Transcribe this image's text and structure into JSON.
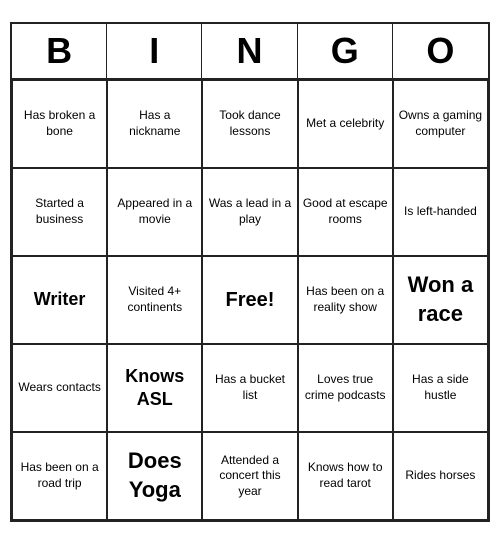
{
  "header": {
    "letters": [
      "B",
      "I",
      "N",
      "G",
      "O"
    ]
  },
  "cells": [
    {
      "text": "Has broken a bone",
      "size": "normal"
    },
    {
      "text": "Has a nickname",
      "size": "normal"
    },
    {
      "text": "Took dance lessons",
      "size": "normal"
    },
    {
      "text": "Met a celebrity",
      "size": "normal"
    },
    {
      "text": "Owns a gaming computer",
      "size": "normal"
    },
    {
      "text": "Started a business",
      "size": "normal"
    },
    {
      "text": "Appeared in a movie",
      "size": "normal"
    },
    {
      "text": "Was a lead in a play",
      "size": "normal"
    },
    {
      "text": "Good at escape rooms",
      "size": "normal"
    },
    {
      "text": "Is left-handed",
      "size": "normal"
    },
    {
      "text": "Writer",
      "size": "large"
    },
    {
      "text": "Visited 4+ continents",
      "size": "normal"
    },
    {
      "text": "Free!",
      "size": "free"
    },
    {
      "text": "Has been on a reality show",
      "size": "normal"
    },
    {
      "text": "Won a race",
      "size": "xl"
    },
    {
      "text": "Wears contacts",
      "size": "normal"
    },
    {
      "text": "Knows ASL",
      "size": "large"
    },
    {
      "text": "Has a bucket list",
      "size": "normal"
    },
    {
      "text": "Loves true crime podcasts",
      "size": "normal"
    },
    {
      "text": "Has a side hustle",
      "size": "normal"
    },
    {
      "text": "Has been on a road trip",
      "size": "normal"
    },
    {
      "text": "Does Yoga",
      "size": "xl"
    },
    {
      "text": "Attended a concert this year",
      "size": "normal"
    },
    {
      "text": "Knows how to read tarot",
      "size": "normal"
    },
    {
      "text": "Rides horses",
      "size": "normal"
    }
  ]
}
